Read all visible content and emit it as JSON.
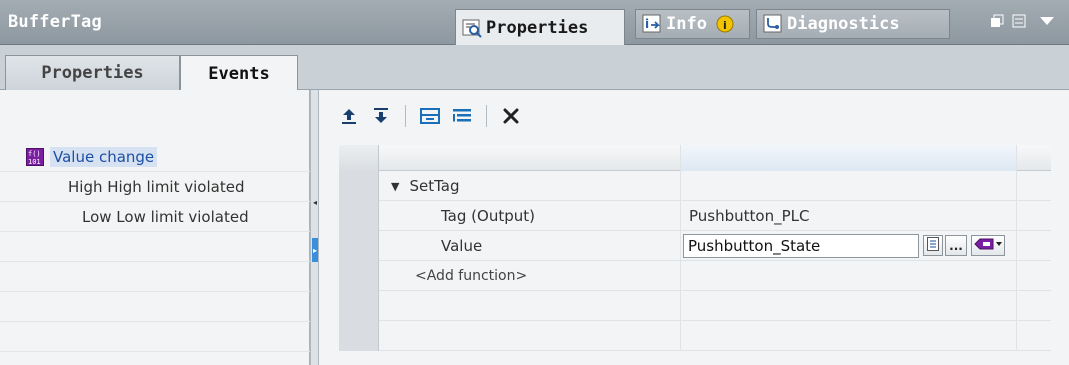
{
  "window": {
    "title": "BufferTag",
    "tabs": [
      {
        "label": "Properties",
        "icon": "properties-icon",
        "active": true
      },
      {
        "label": "Info",
        "icon": "info-icon",
        "active": false
      },
      {
        "label": "Diagnostics",
        "icon": "diagnostics-icon",
        "active": false
      }
    ],
    "info_badge_icon": "info-badge-icon"
  },
  "left_tabs": [
    {
      "label": "Properties",
      "active": false
    },
    {
      "label": "Events",
      "active": true
    }
  ],
  "events": [
    {
      "label": "Value change",
      "selected": true,
      "icon": "value-change-event-icon"
    },
    {
      "label": "High High limit violated",
      "selected": false
    },
    {
      "label": "Low Low limit violated",
      "selected": false
    }
  ],
  "toolbar": {
    "buttons": [
      "move-up-icon",
      "move-down-icon",
      "collapse-icon",
      "expand-all-icon",
      "delete-icon"
    ]
  },
  "function_list": {
    "function_name": "SetTag",
    "params": [
      {
        "name": "Tag (Output)",
        "value": "Pushbutton_PLC"
      },
      {
        "name": "Value",
        "value": "Pushbutton_State"
      }
    ],
    "add_function_label": "<Add function>",
    "ellipsis_label": "..."
  },
  "colors": {
    "title_bar": "#8e98a0",
    "selection_blue": "#1d4fa3",
    "splitter_arrow": "#3a8fdd",
    "tag_purple": "#7a1fa2"
  }
}
